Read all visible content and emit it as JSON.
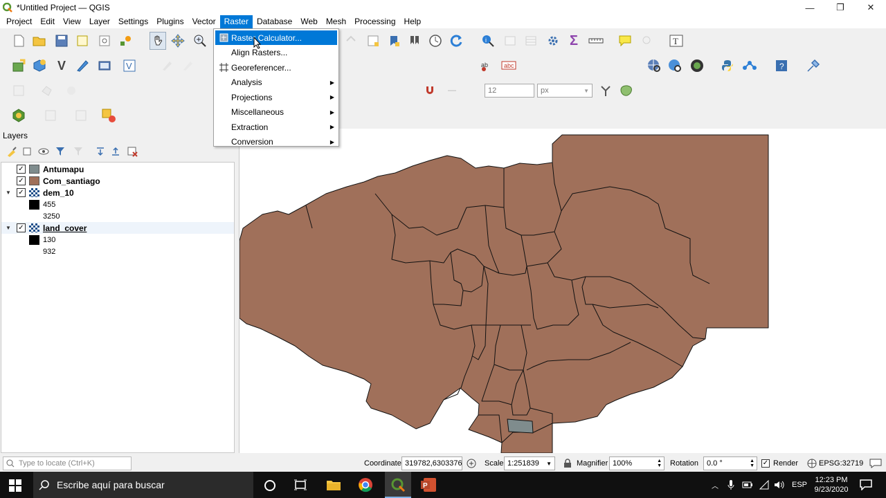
{
  "window": {
    "title": "*Untitled Project — QGIS",
    "icons": [
      "qgis-logo",
      "minimize-icon",
      "restore-icon",
      "close-icon"
    ]
  },
  "menubar": {
    "items": [
      "Project",
      "Edit",
      "View",
      "Layer",
      "Settings",
      "Plugins",
      "Vector",
      "Raster",
      "Database",
      "Web",
      "Mesh",
      "Processing",
      "Help"
    ],
    "active": "Raster"
  },
  "raster_menu": {
    "items": [
      {
        "label": "Raster Calculator...",
        "highlighted": true,
        "icon": "raster-calculator-icon",
        "submenu": false
      },
      {
        "label": "Align Rasters...",
        "highlighted": false,
        "icon": "",
        "submenu": false
      },
      {
        "label": "Georeferencer...",
        "highlighted": false,
        "icon": "grid-icon",
        "submenu": false
      },
      {
        "label": "Analysis",
        "highlighted": false,
        "icon": "",
        "submenu": true
      },
      {
        "label": "Projections",
        "highlighted": false,
        "icon": "",
        "submenu": true
      },
      {
        "label": "Miscellaneous",
        "highlighted": false,
        "icon": "",
        "submenu": true
      },
      {
        "label": "Extraction",
        "highlighted": false,
        "icon": "",
        "submenu": true
      },
      {
        "label": "Conversion",
        "highlighted": false,
        "icon": "",
        "submenu": true
      }
    ]
  },
  "toolbar": {
    "font_size_value": "12",
    "unit_value": "px"
  },
  "layers_panel": {
    "title": "Layers",
    "layers": [
      {
        "name": "Antumapu",
        "checked": true,
        "swatch": "#7f8c8d",
        "type": "vector"
      },
      {
        "name": "Com_santiago",
        "checked": true,
        "swatch": "#a0705a",
        "type": "vector"
      },
      {
        "name": "dem_10",
        "checked": true,
        "type": "raster",
        "expanded": true,
        "legend": [
          "455",
          "3250"
        ]
      },
      {
        "name": "land_cover",
        "checked": true,
        "type": "raster",
        "expanded": true,
        "selected": true,
        "legend": [
          "130",
          "932"
        ]
      }
    ]
  },
  "map": {
    "fill_color": "#a0705a",
    "highlight_fill": "#7f8c8d"
  },
  "statusbar": {
    "locate_placeholder": "Type to locate (Ctrl+K)",
    "coordinate_label": "Coordinate",
    "coordinate_value": "319782,6303376",
    "scale_label": "Scale",
    "scale_value": "1:251839",
    "magnifier_label": "Magnifier",
    "magnifier_value": "100%",
    "rotation_label": "Rotation",
    "rotation_value": "0.0 °",
    "render_label": "Render",
    "crs": "EPSG:32719"
  },
  "taskbar": {
    "search_placeholder": "Escribe aquí para buscar",
    "language": "ESP",
    "time": "12:23 PM",
    "date": "9/23/2020"
  }
}
